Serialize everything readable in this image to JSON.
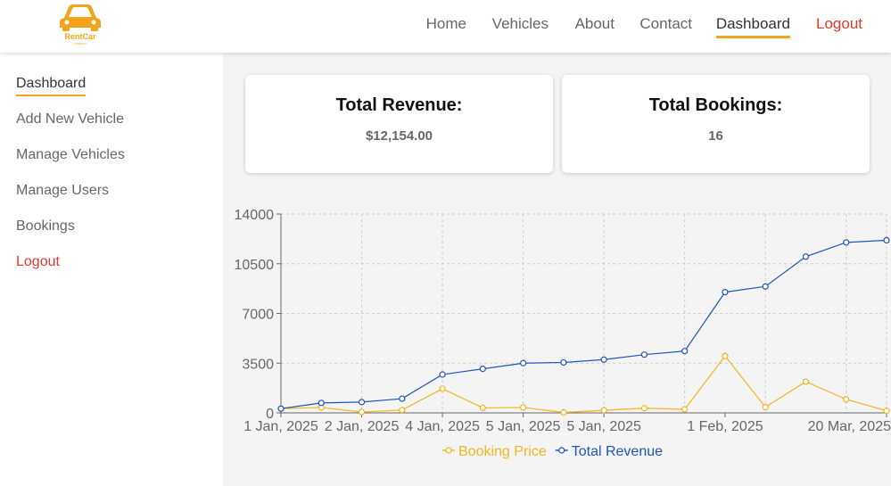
{
  "brand": {
    "name": "RentCar",
    "tagline": "COMPANY",
    "accent": "#f2a51a"
  },
  "nav": {
    "items": [
      {
        "label": "Home"
      },
      {
        "label": "Vehicles"
      },
      {
        "label": "About"
      },
      {
        "label": "Contact"
      },
      {
        "label": "Dashboard",
        "active": true
      },
      {
        "label": "Logout"
      }
    ]
  },
  "sidebar": {
    "items": [
      {
        "label": "Dashboard",
        "active": true
      },
      {
        "label": "Add New Vehicle"
      },
      {
        "label": "Manage Vehicles"
      },
      {
        "label": "Manage Users"
      },
      {
        "label": "Bookings"
      },
      {
        "label": "Logout"
      }
    ]
  },
  "stats": {
    "revenue": {
      "title": "Total Revenue:",
      "value": "$12,154.00"
    },
    "bookings": {
      "title": "Total Bookings:",
      "value": "16"
    }
  },
  "colors": {
    "logout": "#e0392d",
    "booking_price": "#f2b519",
    "total_revenue": "#1e56b8"
  },
  "chart_data": {
    "type": "line",
    "title": "",
    "xlabel": "",
    "ylabel": "",
    "ylim": [
      0,
      14000
    ],
    "yticks": [
      0,
      3500,
      7000,
      10500,
      14000
    ],
    "grid": true,
    "legend_position": "bottom",
    "x": [
      "1 Jan, 2025",
      "1 Jan, 2025",
      "2 Jan, 2025",
      "2 Jan, 2025",
      "4 Jan, 2025",
      "4 Jan, 2025",
      "5 Jan, 2025",
      "5 Jan, 2025",
      "5 Jan, 2025",
      "5 Jan, 2025",
      "1 Feb, 2025",
      "1 Feb, 2025",
      "1 Feb, 2025",
      "20 Mar, 2025",
      "20 Mar, 2025",
      "20 Mar, 2025"
    ],
    "x_tick_labels": [
      "1 Jan, 2025",
      "2 Jan, 2025",
      "4 Jan, 2025",
      "5 Jan, 2025",
      "5 Jan, 2025",
      "1 Feb, 2025",
      "20 Mar, 2025"
    ],
    "series": [
      {
        "name": "Booking Price",
        "color": "#f2b519",
        "values": [
          300,
          380,
          60,
          200,
          1700,
          350,
          380,
          30,
          180,
          330,
          250,
          4000,
          400,
          2200,
          950,
          150
        ]
      },
      {
        "name": "Total Revenue",
        "color": "#1e56b8",
        "values": [
          300,
          700,
          760,
          1000,
          2700,
          3100,
          3500,
          3550,
          3750,
          4100,
          4350,
          8500,
          8900,
          11000,
          12000,
          12154
        ]
      }
    ]
  }
}
